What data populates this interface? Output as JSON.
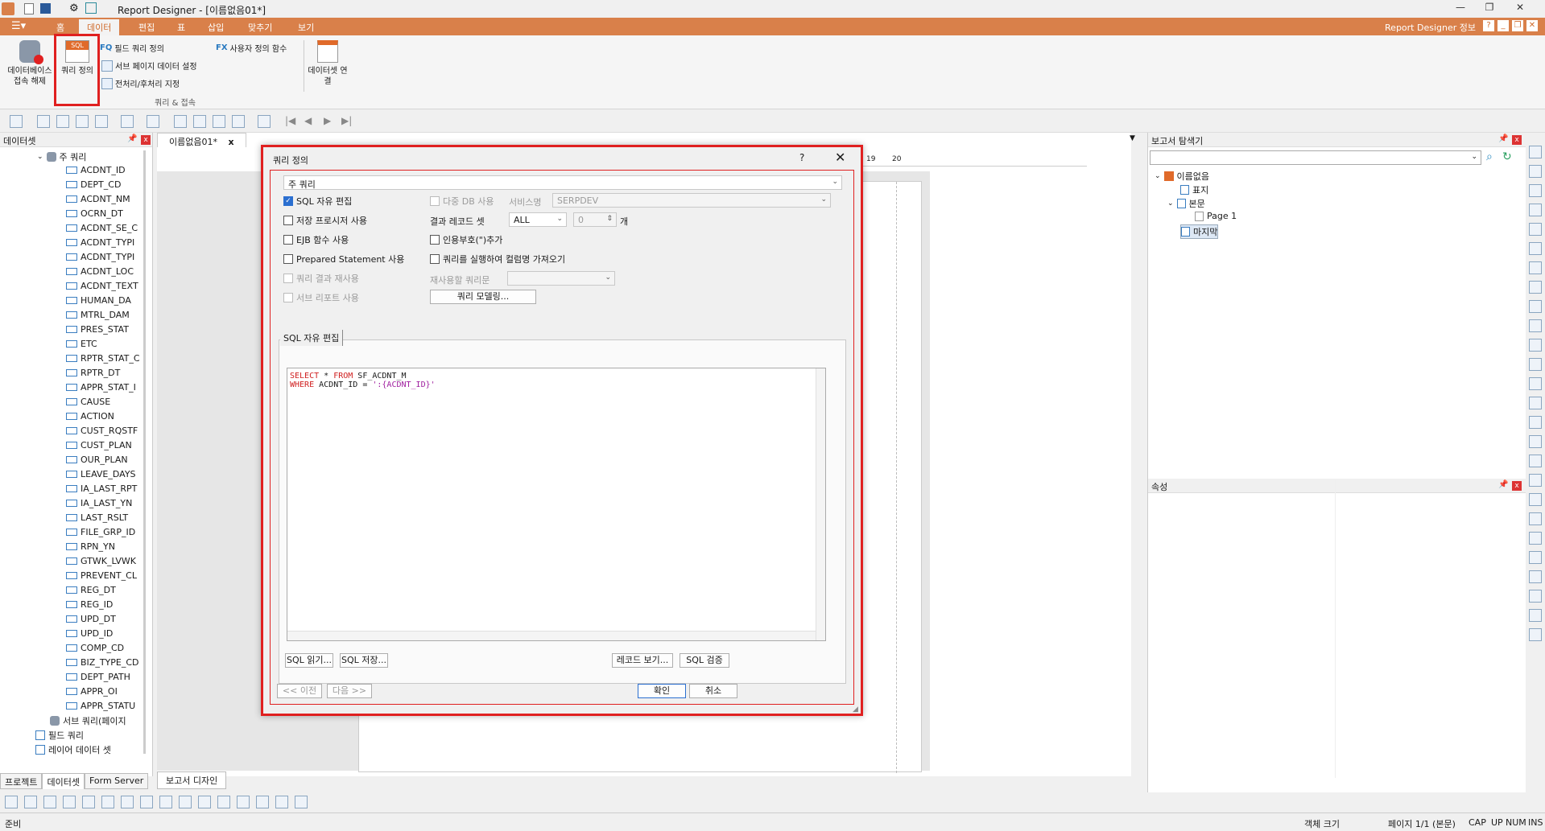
{
  "window": {
    "title": "Report Designer - [이름없음01*]"
  },
  "menubar": {
    "tabs": [
      "홈",
      "데이터",
      "편집",
      "표",
      "삽입",
      "맞추기",
      "보기"
    ],
    "info": "Report Designer 정보"
  },
  "ribbon": {
    "db_disconnect": "데이터베이스 접속 해제",
    "query_define": "쿼리 정의",
    "sql_badge": "SQL",
    "field_query": "필드 쿼리 정의",
    "sub_page_data": "서브 페이지 데이터 설정",
    "pre_post": "전처리/후처리 지정",
    "user_func": "사용자 정의 함수",
    "dataset_link": "데이터셋 연결",
    "group_label": "쿼리 & 접속",
    "fq_label": "FQ",
    "fx_label": "FX"
  },
  "left_panel": {
    "title": "데이터셋",
    "main_query": "주 쿼리",
    "fields": [
      "ACDNT_ID",
      "DEPT_CD",
      "ACDNT_NM",
      "OCRN_DT",
      "ACDNT_SE_C",
      "ACDNT_TYPI",
      "ACDNT_TYPI",
      "ACDNT_LOC",
      "ACDNT_TEXT",
      "HUMAN_DA",
      "MTRL_DAM",
      "PRES_STAT",
      "ETC",
      "RPTR_STAT_C",
      "RPTR_DT",
      "APPR_STAT_I",
      "CAUSE",
      "ACTION",
      "CUST_RQSTF",
      "CUST_PLAN",
      "OUR_PLAN",
      "LEAVE_DAYS",
      "IA_LAST_RPT",
      "IA_LAST_YN",
      "LAST_RSLT",
      "FILE_GRP_ID",
      "RPN_YN",
      "GTWK_LVWK",
      "PREVENT_CL",
      "REG_DT",
      "REG_ID",
      "UPD_DT",
      "UPD_ID",
      "COMP_CD",
      "BIZ_TYPE_CD",
      "DEPT_PATH",
      "APPR_OI",
      "APPR_STATU"
    ],
    "sub_query": "서브 쿼리(페이지",
    "field_query": "필드 쿼리",
    "layer_dataset": "레이어 데이터 셋",
    "tabs": [
      "프로젝트",
      "데이터셋",
      "Form Server"
    ]
  },
  "canvas": {
    "doc_tab": "이름없음01*",
    "close": "x",
    "design_tab": "보고서 디자인",
    "ruler_19": "19",
    "ruler_20": "20"
  },
  "right_panel": {
    "explorer_title": "보고서 탐색기",
    "tree": [
      "이름없음",
      "표지",
      "본문",
      "Page 1",
      "마지막"
    ],
    "props_title": "속성"
  },
  "dialog": {
    "title": "쿼리 정의",
    "help": "?",
    "close": "✕",
    "query_select": "주 쿼리",
    "sql_free_edit": "SQL 자유 편집",
    "stored_proc": "저장 프로시저 사용",
    "ejb_func": "EJB 함수 사용",
    "prepared": "Prepared Statement 사용",
    "reuse_result": "쿼리 결과 재사용",
    "sub_report": "서브 리포트 사용",
    "multi_db": "다중 DB 사용",
    "service_name": "서비스명",
    "service_value": "SERPDEV",
    "result_set": "결과 레코드 셋",
    "result_value": "ALL",
    "count_value": "0",
    "count_unit": "개",
    "quote_add": "인용부호(\")추가",
    "fetch_cols": "쿼리를 실행하여 컬럼명 가져오기",
    "reuse_query": "재사용할 쿼리문",
    "modeling": "쿼리 모델링...",
    "sql_tab": "SQL 자유 편집",
    "sql_line1_kw": "SELECT",
    "sql_line1_rest": " * ",
    "sql_line1_kw2": "FROM",
    "sql_line1_table": " SF_ACDNT_M",
    "sql_line2_kw": "WHERE",
    "sql_line2_rest": " ACDNT_ID = ",
    "sql_line2_str": "':{ACDNT_ID}'",
    "read_sql": "SQL 읽기...",
    "save_sql": "SQL 저장...",
    "record_view": "레코드 보기...",
    "sql_verify": "SQL 검증",
    "prev": "<< 이전",
    "next": "다음 >>",
    "ok": "확인",
    "cancel": "취소"
  },
  "status": {
    "ready": "준비",
    "obj_size": "객체 크기",
    "page": "페이지 1/1 (본문)",
    "cap": "CAP",
    "up": "UP",
    "num": "NUM",
    "ins": "INS"
  },
  "colors": {
    "accent": "#d9804a",
    "highlight": "#e02020"
  }
}
